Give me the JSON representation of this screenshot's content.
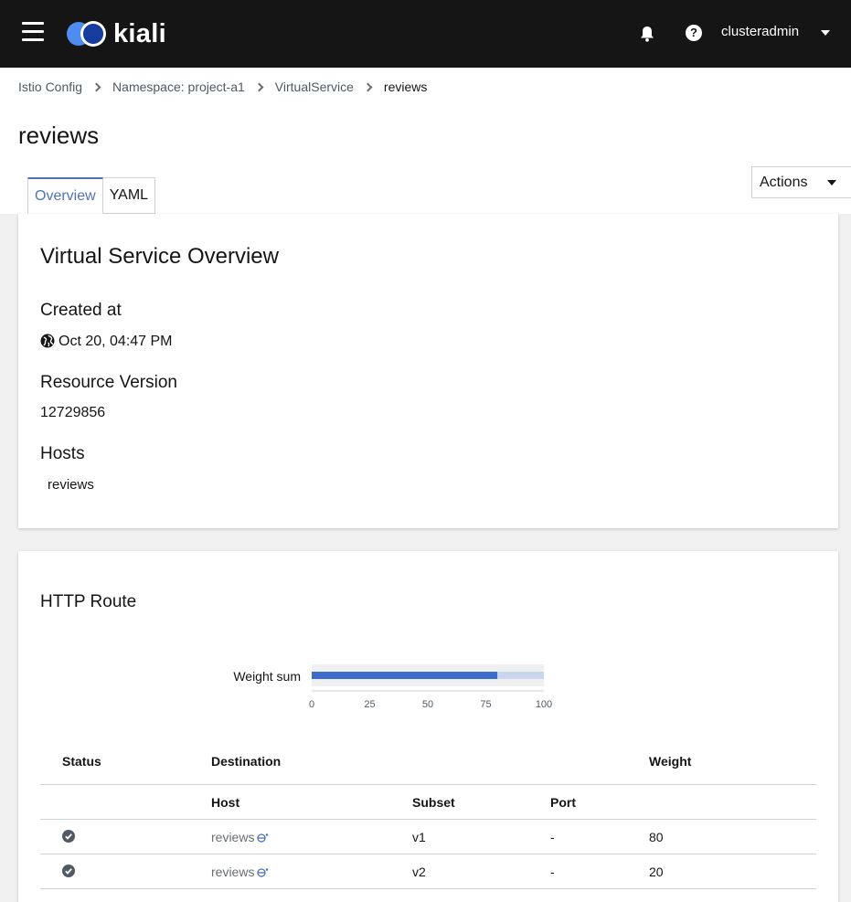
{
  "header": {
    "brand": "kiali",
    "user": "clusteradmin",
    "help_glyph": "?"
  },
  "breadcrumb": {
    "items": [
      "Istio Config",
      "Namespace: project-a1",
      "VirtualService"
    ],
    "current": "reviews"
  },
  "page": {
    "title": "reviews",
    "tabs": [
      "Overview",
      "YAML"
    ],
    "active_tab": "Overview",
    "actions_label": "Actions"
  },
  "overview": {
    "title": "Virtual Service Overview",
    "created_label": "Created at",
    "created_value": "Oct 20, 04:47 PM",
    "resource_version_label": "Resource Version",
    "resource_version_value": "12729856",
    "hosts_label": "Hosts",
    "hosts_value": "reviews"
  },
  "http_route": {
    "title": "HTTP Route",
    "chart_label": "Weight sum",
    "table": {
      "headers": {
        "status": "Status",
        "destination": "Destination",
        "weight": "Weight"
      },
      "subheaders": {
        "host": "Host",
        "subset": "Subset",
        "port": "Port"
      },
      "rows": [
        {
          "host": "reviews",
          "subset": "v1",
          "port": "-",
          "weight": "80"
        },
        {
          "host": "reviews",
          "subset": "v2",
          "port": "-",
          "weight": "20"
        }
      ]
    }
  },
  "chart_data": {
    "type": "bar",
    "categories": [
      "Weight sum"
    ],
    "series": [
      {
        "values": [
          80
        ],
        "color": "#3e6ccb"
      },
      {
        "values": [
          20
        ],
        "color": "#c9d6ec"
      }
    ],
    "xlim": [
      0,
      100
    ],
    "xticks": [
      "0",
      "25",
      "50",
      "75",
      "100"
    ],
    "stacked": true,
    "orientation": "horizontal"
  },
  "colors": {
    "masthead": "#151515",
    "link": "#4f5a66",
    "accent": "#4f72b8",
    "status_ok": "#515a63"
  }
}
